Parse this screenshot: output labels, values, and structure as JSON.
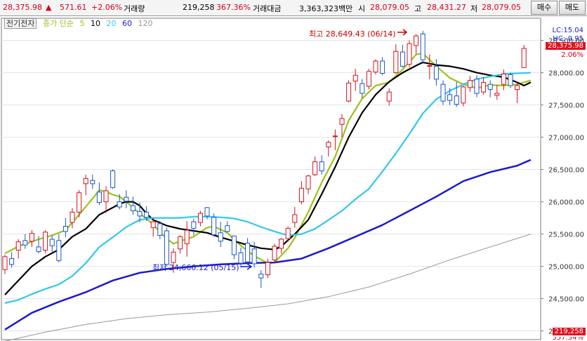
{
  "topbar": {
    "price": "28,375.98",
    "arrow": "▲",
    "change": "571.61",
    "change_pct": "+2.06%",
    "volume_label": "거래량",
    "volume": "219,258",
    "volume_pct": "367.36%",
    "amount_label": "거래대금",
    "amount": "3,363,323백만",
    "open_label": "시",
    "open": "28,079.05",
    "high_label": "고",
    "high": "28,431.27",
    "low_label": "저",
    "low": "28,079.05",
    "buy_label": "매수",
    "sell_label": "매도"
  },
  "legend": {
    "stock_name": "전기전자",
    "ma_label": "종가 단순",
    "periods": [
      "5",
      "10",
      "20",
      "60",
      "120"
    ],
    "colors": [
      "#9bc31a",
      "#000000",
      "#33c7ee",
      "#1a1ad0",
      "#9a9a9a"
    ]
  },
  "right_panel": {
    "lc": "LC:15.04",
    "hc": "HC:-0.95",
    "last_price": "28,375.98",
    "last_pct": "2.06%",
    "volume_box": "219,258",
    "cut_text": "357.34%"
  },
  "chart_data": {
    "type": "candlestick",
    "title": "",
    "ylim": [
      23800,
      28800
    ],
    "y_ticks": [
      28500,
      28000,
      27500,
      27000,
      26500,
      26000,
      25500,
      25000,
      24500,
      24000
    ],
    "y_tick_labels": [
      "28,500.00",
      "28,000.00",
      "27,500.00",
      "27,000.00",
      "26,500.00",
      "26,000.00",
      "25,500.00",
      "25,000.00",
      "24,500.00",
      "24,000.00"
    ],
    "annotations": {
      "high": {
        "text": "최고 28,649.43 (06/14)",
        "value": 28649.43
      },
      "low": {
        "text": "최저 24,666.12 (05/15)",
        "value": 24666.12
      }
    },
    "candles": [
      {
        "o": 24950,
        "h": 25180,
        "l": 24880,
        "c": 25150
      },
      {
        "o": 25120,
        "h": 25220,
        "l": 24980,
        "c": 25030
      },
      {
        "o": 25250,
        "h": 25420,
        "l": 25120,
        "c": 25380
      },
      {
        "o": 25400,
        "h": 25500,
        "l": 25270,
        "c": 25330
      },
      {
        "o": 25390,
        "h": 25560,
        "l": 25300,
        "c": 25510
      },
      {
        "o": 25300,
        "h": 25470,
        "l": 25200,
        "c": 25230
      },
      {
        "o": 25250,
        "h": 25560,
        "l": 25200,
        "c": 25530
      },
      {
        "o": 25420,
        "h": 25480,
        "l": 25220,
        "c": 25320
      },
      {
        "o": 25400,
        "h": 25500,
        "l": 25060,
        "c": 25090
      },
      {
        "o": 25620,
        "h": 25750,
        "l": 25450,
        "c": 25540
      },
      {
        "o": 25680,
        "h": 25900,
        "l": 25590,
        "c": 25840
      },
      {
        "o": 25840,
        "h": 26180,
        "l": 25760,
        "c": 26140
      },
      {
        "o": 26280,
        "h": 26420,
        "l": 26100,
        "c": 26360
      },
      {
        "o": 26330,
        "h": 26420,
        "l": 26200,
        "c": 26280
      },
      {
        "o": 26150,
        "h": 26300,
        "l": 25950,
        "c": 25990
      },
      {
        "o": 26000,
        "h": 26240,
        "l": 25830,
        "c": 26170
      },
      {
        "o": 26480,
        "h": 26500,
        "l": 26200,
        "c": 26220
      },
      {
        "o": 26000,
        "h": 26120,
        "l": 25880,
        "c": 25920
      },
      {
        "o": 26070,
        "h": 26180,
        "l": 25900,
        "c": 26010
      },
      {
        "o": 25940,
        "h": 26080,
        "l": 25800,
        "c": 25860
      },
      {
        "o": 25850,
        "h": 25990,
        "l": 25680,
        "c": 25780
      },
      {
        "o": 25840,
        "h": 25930,
        "l": 25700,
        "c": 25760
      },
      {
        "o": 25600,
        "h": 25750,
        "l": 25460,
        "c": 25690
      },
      {
        "o": 25660,
        "h": 25700,
        "l": 25420,
        "c": 25480
      },
      {
        "o": 25550,
        "h": 25600,
        "l": 25000,
        "c": 25030
      },
      {
        "o": 25060,
        "h": 25280,
        "l": 24900,
        "c": 25220
      },
      {
        "o": 25270,
        "h": 25480,
        "l": 25200,
        "c": 25460
      },
      {
        "o": 25350,
        "h": 25700,
        "l": 25150,
        "c": 25560
      },
      {
        "o": 25690,
        "h": 25740,
        "l": 25480,
        "c": 25590
      },
      {
        "o": 25680,
        "h": 25860,
        "l": 25620,
        "c": 25820
      },
      {
        "o": 25910,
        "h": 25920,
        "l": 25730,
        "c": 25780
      },
      {
        "o": 25760,
        "h": 25820,
        "l": 25460,
        "c": 25490
      },
      {
        "o": 25520,
        "h": 25690,
        "l": 25300,
        "c": 25390
      },
      {
        "o": 25630,
        "h": 25700,
        "l": 25530,
        "c": 25540
      },
      {
        "o": 25470,
        "h": 25480,
        "l": 25110,
        "c": 25180
      },
      {
        "o": 25210,
        "h": 25290,
        "l": 24980,
        "c": 25050
      },
      {
        "o": 25360,
        "h": 25440,
        "l": 25040,
        "c": 25070
      },
      {
        "o": 25270,
        "h": 25380,
        "l": 24980,
        "c": 25040
      },
      {
        "o": 24880,
        "h": 24940,
        "l": 24666.12,
        "c": 24820
      },
      {
        "o": 24870,
        "h": 25120,
        "l": 24820,
        "c": 25060
      },
      {
        "o": 25100,
        "h": 25350,
        "l": 25050,
        "c": 25310
      },
      {
        "o": 25280,
        "h": 25440,
        "l": 25200,
        "c": 25420
      },
      {
        "o": 25430,
        "h": 25620,
        "l": 25380,
        "c": 25590
      },
      {
        "o": 25680,
        "h": 25920,
        "l": 25600,
        "c": 25800
      },
      {
        "o": 26000,
        "h": 26320,
        "l": 25960,
        "c": 26210
      },
      {
        "o": 26200,
        "h": 26420,
        "l": 26120,
        "c": 26400
      },
      {
        "o": 26420,
        "h": 26700,
        "l": 26400,
        "c": 26620
      },
      {
        "o": 26620,
        "h": 26720,
        "l": 26420,
        "c": 26480
      },
      {
        "o": 26850,
        "h": 26950,
        "l": 26700,
        "c": 26920
      },
      {
        "o": 27020,
        "h": 27120,
        "l": 26800,
        "c": 27020
      },
      {
        "o": 27200,
        "h": 27360,
        "l": 27000,
        "c": 27290
      },
      {
        "o": 27560,
        "h": 27880,
        "l": 27540,
        "c": 27840
      },
      {
        "o": 27870,
        "h": 28060,
        "l": 27720,
        "c": 27960
      },
      {
        "o": 27830,
        "h": 27900,
        "l": 27600,
        "c": 27680
      },
      {
        "o": 27790,
        "h": 28060,
        "l": 27740,
        "c": 28020
      },
      {
        "o": 28010,
        "h": 28210,
        "l": 27970,
        "c": 28180
      },
      {
        "o": 28180,
        "h": 28240,
        "l": 27960,
        "c": 27990
      },
      {
        "o": 27560,
        "h": 27760,
        "l": 27490,
        "c": 27700
      },
      {
        "o": 28000,
        "h": 28440,
        "l": 27980,
        "c": 28330
      },
      {
        "o": 28320,
        "h": 28430,
        "l": 28080,
        "c": 28100
      },
      {
        "o": 28130,
        "h": 28500,
        "l": 28080,
        "c": 28450
      },
      {
        "o": 28420,
        "h": 28600,
        "l": 28290,
        "c": 28570
      },
      {
        "o": 28600,
        "h": 28649.43,
        "l": 28140,
        "c": 28200
      },
      {
        "o": 28110,
        "h": 28280,
        "l": 27900,
        "c": 28110
      },
      {
        "o": 28100,
        "h": 28210,
        "l": 27800,
        "c": 27900
      },
      {
        "o": 27820,
        "h": 27880,
        "l": 27500,
        "c": 27560
      },
      {
        "o": 27660,
        "h": 27760,
        "l": 27500,
        "c": 27570
      },
      {
        "o": 27640,
        "h": 27860,
        "l": 27470,
        "c": 27510
      },
      {
        "o": 27530,
        "h": 27800,
        "l": 27480,
        "c": 27780
      },
      {
        "o": 27770,
        "h": 27950,
        "l": 27700,
        "c": 27880
      },
      {
        "o": 27900,
        "h": 27960,
        "l": 27620,
        "c": 27680
      },
      {
        "o": 27700,
        "h": 27930,
        "l": 27660,
        "c": 27850
      },
      {
        "o": 27820,
        "h": 27880,
        "l": 27620,
        "c": 27740
      },
      {
        "o": 27650,
        "h": 27810,
        "l": 27580,
        "c": 27680
      },
      {
        "o": 27820,
        "h": 28050,
        "l": 27730,
        "c": 27980
      },
      {
        "o": 27970,
        "h": 28000,
        "l": 27760,
        "c": 27800
      },
      {
        "o": 27740,
        "h": 27860,
        "l": 27530,
        "c": 27800
      },
      {
        "o": 28079.05,
        "h": 28431.27,
        "l": 28079.05,
        "c": 28375.98
      }
    ],
    "series": [
      {
        "name": "5",
        "color": "#9bc31a",
        "values": [
          [
            0,
            25200
          ],
          [
            2,
            25310
          ],
          [
            5,
            25420
          ],
          [
            7,
            25480
          ],
          [
            9,
            25560
          ],
          [
            11,
            25800
          ],
          [
            13,
            26050
          ],
          [
            14,
            26180
          ],
          [
            15,
            26160
          ],
          [
            16,
            26110
          ],
          [
            17,
            26080
          ],
          [
            18,
            26000
          ],
          [
            20,
            25820
          ],
          [
            22,
            25650
          ],
          [
            23,
            25530
          ],
          [
            24,
            25430
          ],
          [
            25,
            25350
          ],
          [
            26,
            25390
          ],
          [
            28,
            25460
          ],
          [
            30,
            25600
          ],
          [
            31,
            25620
          ],
          [
            33,
            25520
          ],
          [
            35,
            25320
          ],
          [
            37,
            25160
          ],
          [
            39,
            25050
          ],
          [
            40,
            25060
          ],
          [
            42,
            25280
          ],
          [
            43,
            25440
          ],
          [
            45,
            25840
          ],
          [
            47,
            26300
          ],
          [
            49,
            26700
          ],
          [
            51,
            27260
          ],
          [
            53,
            27600
          ],
          [
            55,
            27800
          ],
          [
            57,
            27850
          ],
          [
            59,
            28050
          ],
          [
            61,
            28280
          ],
          [
            62,
            28300
          ],
          [
            64,
            28100
          ],
          [
            66,
            27920
          ],
          [
            68,
            27820
          ],
          [
            70,
            27760
          ],
          [
            72,
            27810
          ],
          [
            74,
            27800
          ],
          [
            76,
            27820
          ],
          [
            78,
            27880
          ]
        ]
      },
      {
        "name": "10",
        "color": "#000000",
        "values": [
          [
            0,
            24560
          ],
          [
            2,
            24780
          ],
          [
            4,
            25000
          ],
          [
            6,
            25150
          ],
          [
            8,
            25260
          ],
          [
            10,
            25460
          ],
          [
            12,
            25580
          ],
          [
            14,
            25800
          ],
          [
            16,
            25910
          ],
          [
            17,
            25970
          ],
          [
            18,
            26000
          ],
          [
            19,
            26000
          ],
          [
            20,
            25940
          ],
          [
            21,
            25820
          ],
          [
            22,
            25720
          ],
          [
            24,
            25630
          ],
          [
            26,
            25580
          ],
          [
            28,
            25550
          ],
          [
            30,
            25520
          ],
          [
            32,
            25450
          ],
          [
            34,
            25390
          ],
          [
            36,
            25330
          ],
          [
            38,
            25280
          ],
          [
            40,
            25260
          ],
          [
            41,
            25310
          ],
          [
            43,
            25500
          ],
          [
            45,
            25720
          ],
          [
            47,
            26120
          ],
          [
            49,
            26540
          ],
          [
            51,
            27000
          ],
          [
            53,
            27380
          ],
          [
            55,
            27660
          ],
          [
            57,
            27860
          ],
          [
            59,
            28000
          ],
          [
            61,
            28110
          ],
          [
            62,
            28160
          ],
          [
            64,
            28120
          ],
          [
            66,
            28100
          ],
          [
            68,
            28060
          ],
          [
            70,
            28000
          ],
          [
            72,
            27960
          ],
          [
            74,
            27930
          ],
          [
            76,
            27850
          ],
          [
            77,
            27800
          ],
          [
            78,
            27850
          ]
        ]
      },
      {
        "name": "20",
        "color": "#33c7ee",
        "values": [
          [
            0,
            24430
          ],
          [
            2,
            24480
          ],
          [
            4,
            24570
          ],
          [
            6,
            24650
          ],
          [
            8,
            24720
          ],
          [
            10,
            24850
          ],
          [
            12,
            25050
          ],
          [
            14,
            25300
          ],
          [
            16,
            25450
          ],
          [
            18,
            25610
          ],
          [
            20,
            25720
          ],
          [
            22,
            25750
          ],
          [
            24,
            25750
          ],
          [
            26,
            25750
          ],
          [
            28,
            25770
          ],
          [
            30,
            25770
          ],
          [
            32,
            25760
          ],
          [
            34,
            25740
          ],
          [
            36,
            25690
          ],
          [
            38,
            25610
          ],
          [
            40,
            25540
          ],
          [
            42,
            25480
          ],
          [
            44,
            25500
          ],
          [
            46,
            25580
          ],
          [
            48,
            25720
          ],
          [
            50,
            25860
          ],
          [
            52,
            26040
          ],
          [
            54,
            26200
          ],
          [
            56,
            26470
          ],
          [
            58,
            26750
          ],
          [
            60,
            27050
          ],
          [
            62,
            27370
          ],
          [
            64,
            27590
          ],
          [
            66,
            27720
          ],
          [
            68,
            27820
          ],
          [
            70,
            27900
          ],
          [
            72,
            27940
          ],
          [
            74,
            27980
          ],
          [
            76,
            27990
          ],
          [
            78,
            28000
          ]
        ]
      },
      {
        "name": "60",
        "color": "#1a1ad0",
        "values": [
          [
            0,
            24020
          ],
          [
            4,
            24280
          ],
          [
            8,
            24450
          ],
          [
            12,
            24600
          ],
          [
            16,
            24780
          ],
          [
            20,
            24900
          ],
          [
            24,
            24960
          ],
          [
            28,
            25000
          ],
          [
            32,
            25030
          ],
          [
            36,
            25050
          ],
          [
            40,
            25060
          ],
          [
            44,
            25120
          ],
          [
            48,
            25280
          ],
          [
            52,
            25460
          ],
          [
            56,
            25640
          ],
          [
            60,
            25860
          ],
          [
            64,
            26080
          ],
          [
            68,
            26320
          ],
          [
            72,
            26460
          ],
          [
            76,
            26560
          ],
          [
            78,
            26650
          ]
        ]
      },
      {
        "name": "120",
        "color": "#9a9a9a",
        "values": [
          [
            0,
            23840
          ],
          [
            6,
            23980
          ],
          [
            12,
            24100
          ],
          [
            18,
            24190
          ],
          [
            24,
            24250
          ],
          [
            30,
            24290
          ],
          [
            36,
            24350
          ],
          [
            42,
            24420
          ],
          [
            48,
            24530
          ],
          [
            54,
            24680
          ],
          [
            60,
            24880
          ],
          [
            66,
            25100
          ],
          [
            72,
            25300
          ],
          [
            78,
            25500
          ]
        ]
      }
    ]
  }
}
